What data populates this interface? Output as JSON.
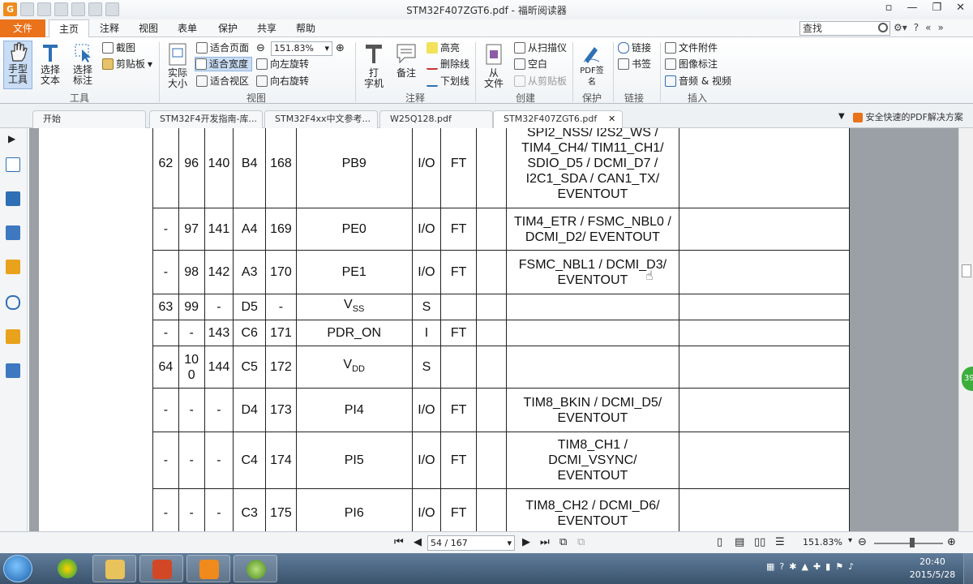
{
  "window": {
    "title": "STM32F407ZGT6.pdf - 福昕阅读器",
    "controls": [
      "▫",
      "—",
      "❐",
      "✕"
    ]
  },
  "ribbon_tabs": {
    "file": "文件",
    "home": "主页",
    "others": [
      "注释",
      "视图",
      "表单",
      "保护",
      "共享",
      "帮助"
    ],
    "search_placeholder": "查找"
  },
  "ribbon": {
    "hand_tool": "手型\n工具",
    "select_text": "选择\n文本",
    "select_annot": "选择\n标注",
    "group_tools": "工具",
    "screenshot": "截图",
    "clipboard": "剪贴板",
    "actual_size": "实际\n大小",
    "fit_page": "适合页面",
    "fit_width": "适合宽度",
    "fit_visible": "适合视区",
    "zoom_value": "151.83%",
    "rotate_left": "向左旋转",
    "rotate_right": "向右旋转",
    "group_view": "视图",
    "typewriter": "打\n字机",
    "note": "备注",
    "highlight": "高亮",
    "strikeout": "删除线",
    "underline": "下划线",
    "group_comment": "注释",
    "from_file": "从\n文件",
    "from_scanner": "从扫描仪",
    "blank": "空白",
    "from_clipboard": "从剪贴板",
    "group_create": "创建",
    "pdf_sign": "PDF签\n名",
    "group_protect": "保护",
    "link": "链接",
    "bookmark": "书签",
    "group_links": "链接",
    "file_attachment": "文件附件",
    "image_annotation": "图像标注",
    "audio_video": "音频 & 视频",
    "group_insert": "插入"
  },
  "doc_tabs": [
    {
      "label": "开始"
    },
    {
      "label": "STM32F4开发指南-库..."
    },
    {
      "label": "STM32F4xx中文参考..."
    },
    {
      "label": "W25Q128.pdf"
    },
    {
      "label": "STM32F407ZGT6.pdf"
    }
  ],
  "promo_text": "安全快速的PDF解决方案",
  "table_rows": [
    {
      "c": [
        "62",
        "96",
        "140",
        "B4",
        "168",
        "PB9",
        "I/O",
        "FT",
        "",
        "SPI2_NSS/ I2S2_WS /\nTIM4_CH4/ TIM11_CH1/\nSDIO_D5 / DCMI_D7 /\nI2C1_SDA / CAN1_TX/\nEVENTOUT",
        ""
      ]
    },
    {
      "c": [
        "-",
        "97",
        "141",
        "A4",
        "169",
        "PE0",
        "I/O",
        "FT",
        "",
        "TIM4_ETR / FSMC_NBL0 /\nDCMI_D2/ EVENTOUT",
        ""
      ]
    },
    {
      "c": [
        "-",
        "98",
        "142",
        "A3",
        "170",
        "PE1",
        "I/O",
        "FT",
        "",
        "FSMC_NBL1 / DCMI_D3/\nEVENTOUT",
        ""
      ]
    },
    {
      "c": [
        "63",
        "99",
        "-",
        "D5",
        "-",
        "V",
        "S",
        "",
        "",
        "",
        ""
      ],
      "sub": "SS"
    },
    {
      "c": [
        "-",
        "-",
        "143",
        "C6",
        "171",
        "PDR_ON",
        "I",
        "FT",
        "",
        "",
        ""
      ]
    },
    {
      "c": [
        "64",
        "10\n0",
        "144",
        "C5",
        "172",
        "V",
        "S",
        "",
        "",
        "",
        ""
      ],
      "sub": "DD"
    },
    {
      "c": [
        "-",
        "-",
        "-",
        "D4",
        "173",
        "PI4",
        "I/O",
        "FT",
        "",
        "TIM8_BKIN / DCMI_D5/\nEVENTOUT",
        ""
      ]
    },
    {
      "c": [
        "-",
        "-",
        "-",
        "C4",
        "174",
        "PI5",
        "I/O",
        "FT",
        "",
        "TIM8_CH1 /\nDCMI_VSYNC/\nEVENTOUT",
        ""
      ]
    },
    {
      "c": [
        "-",
        "-",
        "-",
        "C3",
        "175",
        "PI6",
        "I/O",
        "FT",
        "",
        "TIM8_CH2 / DCMI_D6/\nEVENTOUT",
        ""
      ]
    }
  ],
  "bottom": {
    "page_value": "54 / 167",
    "zoom": "151.83%"
  },
  "taskbar": {
    "time": "20:40",
    "date": "2015/5/28",
    "badge": "39"
  },
  "colors": {
    "accent_orange": "#e9721b",
    "selected_blue": "#c9ddf4"
  }
}
